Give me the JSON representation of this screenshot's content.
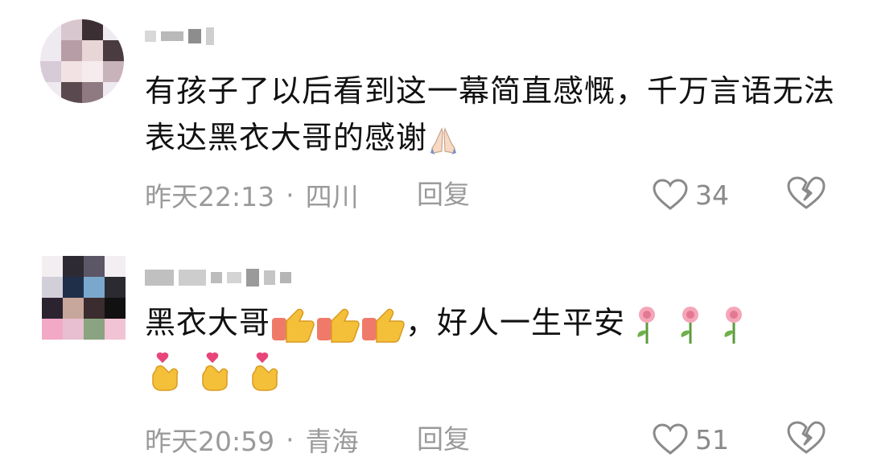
{
  "comments": [
    {
      "text": "有孩子了以后看到这一幕简直感慨，千万言语无法表达黑衣大哥的感谢",
      "emoji": "praying-hands-icon",
      "time": "昨天22:13",
      "location": "四川",
      "separator": "·",
      "reply_label": "回复",
      "likes": "34"
    },
    {
      "text_part1": "黑衣大哥",
      "text_part2": "，好人一生平安",
      "emojis": [
        "thumbs-up-icon",
        "rose-icon",
        "finger-heart-icon"
      ],
      "time": "昨天20:59",
      "location": "青海",
      "separator": "·",
      "reply_label": "回复",
      "likes": "51"
    }
  ],
  "colors": {
    "meta_gray": "#9a9a9a",
    "text": "#111111"
  }
}
